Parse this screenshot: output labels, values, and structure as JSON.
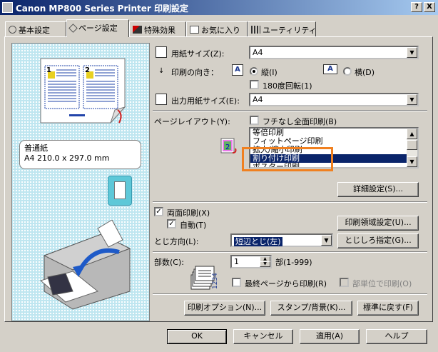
{
  "window": {
    "title": "Canon MP800 Series Printer 印刷設定",
    "help_btn": "?",
    "close_btn": "X"
  },
  "tabs": [
    {
      "label": "基本設定"
    },
    {
      "label": "ページ設定"
    },
    {
      "label": "特殊効果"
    },
    {
      "label": "お気に入り"
    },
    {
      "label": "ユーティリティ"
    }
  ],
  "preview": {
    "paper_type": "普通紙",
    "paper_size": "A4 210.0 x 297.0 mm",
    "page_num_1": "1",
    "page_num_2": "2"
  },
  "page_setup": {
    "paper_size_label": "用紙サイズ(Z):",
    "paper_size_value": "A4",
    "orientation_label": "印刷の向き：",
    "orient_portrait": "縦(I)",
    "orient_landscape": "横(D)",
    "rotate180": "180度回転(1)",
    "output_size_label": "出力用紙サイズ(E):",
    "output_size_value": "A4",
    "layout_label": "ページレイアウト(Y):",
    "borderless": "フチなし全面印刷(B)",
    "layout_options": [
      "等倍印刷",
      "フィットページ印刷",
      "拡大/縮小印刷",
      "割り付け印刷",
      "ポスター印刷"
    ],
    "layout_selected": "割り付け印刷",
    "details_btn": "詳細設定(S)...",
    "duplex": "両面印刷(X)",
    "auto": "自動(T)",
    "print_area_btn": "印刷領域設定(U)...",
    "binding_label": "とじ方向(L):",
    "binding_value": "短辺とじ(左)",
    "margin_btn": "とじしろ指定(G)...",
    "copies_label": "部数(C):",
    "copies_value": "1",
    "copies_range": "部(1-999)",
    "reverse": "最終ページから印刷(R)",
    "collate": "部単位で印刷(O)"
  },
  "bottom_buttons": {
    "print_options": "印刷オプション(N)...",
    "stamp_bg": "スタンプ/背景(K)...",
    "defaults": "標準に戻す(F)"
  },
  "dialog_buttons": {
    "ok": "OK",
    "cancel": "キャンセル",
    "apply": "適用(A)",
    "help": "ヘルプ"
  },
  "colors": {
    "title_start": "#0a246a",
    "title_end": "#a6caf0",
    "selection": "#0a246a",
    "highlight": "#f08020",
    "preview_bg": "#bfe6f0"
  }
}
